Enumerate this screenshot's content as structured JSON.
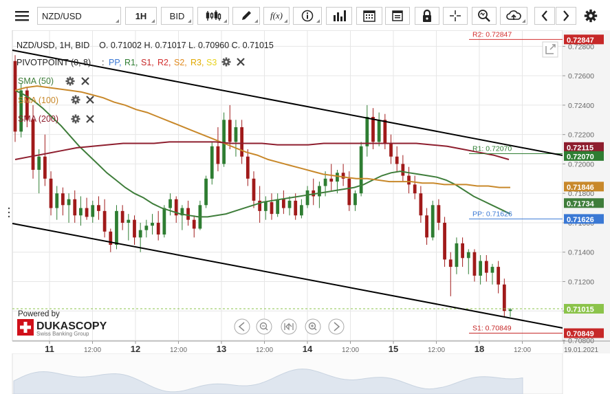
{
  "toolbar": {
    "menu_icon": "hamburger-menu-icon",
    "symbol": "NZD/USD",
    "timeframe": "1H",
    "price_type": "BID",
    "tools": [
      "candles-icon",
      "draw-icon",
      "function-icon",
      "info-icon",
      "volume-icon",
      "calendar-icon",
      "report-icon",
      "lock-icon",
      "crosshair-icon",
      "zoom-icon",
      "upload-icon"
    ],
    "nav_prev_icon": "chevron-left-icon",
    "nav_next_icon": "chevron-right-icon",
    "settings_icon": "gear-icon",
    "function_label": "f(x)"
  },
  "header": {
    "ohlc": "NZD/USD, 1H, BID    O. 0.71002 H. 0.71017 L. 0.70960 C. 0.71015"
  },
  "indicators": {
    "pivot": {
      "name": "PIVOTPOINT (0, 8)",
      "sep": ":",
      "levels": [
        "PP,",
        "R1,",
        "S1,",
        "R2,",
        "S2,",
        "R3,",
        "S3"
      ]
    },
    "sma50": "SMA (50)",
    "sma100": "SMA (100)",
    "sma200": "SMA (200)"
  },
  "branding": {
    "powered_by": "Powered by",
    "name": "DUKASCOPY",
    "tagline": "Swiss Banking Group"
  },
  "colors": {
    "up": "#2e7d32",
    "down": "#a01a1a",
    "sma50": "#3e7d3a",
    "sma100": "#c8882a",
    "sma200": "#8e1e2e",
    "pp": "#3a78d4",
    "r1": "#2e7d32",
    "r2": "#d32f2f",
    "s1": "#c62828",
    "s2": "#e08a1e",
    "r3": "#e0a800",
    "s3": "#e8d21a",
    "grid": "#e6e6e6",
    "trendline": "#000000"
  },
  "chart_data": {
    "type": "candlestick",
    "symbol": "NZD/USD",
    "timeframe": "1H",
    "ylim": [
      0.708,
      0.729
    ],
    "y_ticks": [
      "0.70800",
      "0.71000",
      "0.71200",
      "0.71400",
      "0.71600",
      "0.71800",
      "0.72000",
      "0.72200",
      "0.72400",
      "0.72600",
      "0.72800"
    ],
    "x_ticks": [
      "11",
      "12:00",
      "12",
      "12:00",
      "13",
      "12:00",
      "14",
      "12:00",
      "15",
      "12:00",
      "18",
      "12:00",
      "19.01.2021"
    ],
    "grid": true,
    "candles_ohlc": [
      [
        0.727,
        0.7274,
        0.7215,
        0.7222
      ],
      [
        0.7222,
        0.7255,
        0.7218,
        0.725
      ],
      [
        0.725,
        0.7252,
        0.7225,
        0.723
      ],
      [
        0.723,
        0.724,
        0.719,
        0.7196
      ],
      [
        0.7196,
        0.721,
        0.718,
        0.7205
      ],
      [
        0.7205,
        0.722,
        0.7185,
        0.719
      ],
      [
        0.719,
        0.7195,
        0.7165,
        0.717
      ],
      [
        0.717,
        0.7185,
        0.7162,
        0.718
      ],
      [
        0.718,
        0.7184,
        0.7165,
        0.7172
      ],
      [
        0.7172,
        0.718,
        0.716,
        0.7176
      ],
      [
        0.7176,
        0.7182,
        0.716,
        0.7165
      ],
      [
        0.7165,
        0.7178,
        0.7158,
        0.717
      ],
      [
        0.717,
        0.7177,
        0.7162,
        0.7164
      ],
      [
        0.7164,
        0.7175,
        0.716,
        0.7172
      ],
      [
        0.7172,
        0.7178,
        0.7162,
        0.7168
      ],
      [
        0.7168,
        0.7176,
        0.715,
        0.7154
      ],
      [
        0.7154,
        0.7156,
        0.714,
        0.7145
      ],
      [
        0.7145,
        0.7172,
        0.7142,
        0.7168
      ],
      [
        0.7168,
        0.7172,
        0.7155,
        0.716
      ],
      [
        0.716,
        0.7166,
        0.7148,
        0.7162
      ],
      [
        0.7162,
        0.7165,
        0.7145,
        0.715
      ],
      [
        0.715,
        0.716,
        0.714,
        0.7155
      ],
      [
        0.7155,
        0.7162,
        0.715,
        0.7158
      ],
      [
        0.7158,
        0.7166,
        0.7152,
        0.716
      ],
      [
        0.716,
        0.7168,
        0.7148,
        0.7152
      ],
      [
        0.7152,
        0.7172,
        0.715,
        0.717
      ],
      [
        0.717,
        0.718,
        0.7165,
        0.7176
      ],
      [
        0.7176,
        0.7178,
        0.716,
        0.7165
      ],
      [
        0.7165,
        0.7172,
        0.7155,
        0.717
      ],
      [
        0.717,
        0.7175,
        0.7158,
        0.7162
      ],
      [
        0.7162,
        0.7165,
        0.715,
        0.7156
      ],
      [
        0.7156,
        0.7175,
        0.7155,
        0.7172
      ],
      [
        0.7172,
        0.7192,
        0.717,
        0.719
      ],
      [
        0.719,
        0.7215,
        0.7186,
        0.7212
      ],
      [
        0.7212,
        0.7225,
        0.7195,
        0.72
      ],
      [
        0.72,
        0.7235,
        0.7198,
        0.723
      ],
      [
        0.723,
        0.724,
        0.721,
        0.7215
      ],
      [
        0.7215,
        0.723,
        0.7205,
        0.7225
      ],
      [
        0.7225,
        0.723,
        0.72,
        0.7205
      ],
      [
        0.7205,
        0.721,
        0.7185,
        0.719
      ],
      [
        0.719,
        0.7195,
        0.717,
        0.7175
      ],
      [
        0.7175,
        0.7185,
        0.716,
        0.7168
      ],
      [
        0.7168,
        0.7178,
        0.7162,
        0.7174
      ],
      [
        0.7174,
        0.718,
        0.7162,
        0.7166
      ],
      [
        0.7166,
        0.718,
        0.7164,
        0.7176
      ],
      [
        0.7176,
        0.7182,
        0.7166,
        0.717
      ],
      [
        0.717,
        0.7178,
        0.7165,
        0.7175
      ],
      [
        0.7175,
        0.718,
        0.7162,
        0.7165
      ],
      [
        0.7165,
        0.7176,
        0.7163,
        0.7172
      ],
      [
        0.7172,
        0.7185,
        0.717,
        0.7182
      ],
      [
        0.7182,
        0.719,
        0.7172,
        0.7178
      ],
      [
        0.7178,
        0.7188,
        0.717,
        0.7185
      ],
      [
        0.7185,
        0.7195,
        0.7178,
        0.719
      ],
      [
        0.719,
        0.72,
        0.7182,
        0.7188
      ],
      [
        0.7188,
        0.7196,
        0.718,
        0.7194
      ],
      [
        0.7194,
        0.72,
        0.7185,
        0.719
      ],
      [
        0.719,
        0.7195,
        0.7168,
        0.7172
      ],
      [
        0.7172,
        0.7182,
        0.7168,
        0.718
      ],
      [
        0.718,
        0.7215,
        0.7178,
        0.7212
      ],
      [
        0.7212,
        0.724,
        0.7205,
        0.7232
      ],
      [
        0.7232,
        0.7238,
        0.721,
        0.7215
      ],
      [
        0.7215,
        0.7235,
        0.7212,
        0.723
      ],
      [
        0.723,
        0.7234,
        0.721,
        0.7214
      ],
      [
        0.7214,
        0.722,
        0.72,
        0.7205
      ],
      [
        0.7205,
        0.7212,
        0.7195,
        0.72
      ],
      [
        0.72,
        0.7206,
        0.7188,
        0.7192
      ],
      [
        0.7192,
        0.7198,
        0.718,
        0.7186
      ],
      [
        0.7186,
        0.7192,
        0.7176,
        0.718
      ],
      [
        0.718,
        0.7185,
        0.716,
        0.7165
      ],
      [
        0.7165,
        0.717,
        0.7145,
        0.715
      ],
      [
        0.715,
        0.7175,
        0.7148,
        0.7172
      ],
      [
        0.7172,
        0.7176,
        0.7155,
        0.716
      ],
      [
        0.716,
        0.7164,
        0.713,
        0.7135
      ],
      [
        0.7135,
        0.714,
        0.711,
        0.713
      ],
      [
        0.713,
        0.715,
        0.7125,
        0.7146
      ],
      [
        0.7146,
        0.715,
        0.713,
        0.7136
      ],
      [
        0.7136,
        0.7142,
        0.7125,
        0.714
      ],
      [
        0.714,
        0.7142,
        0.712,
        0.7124
      ],
      [
        0.7124,
        0.7138,
        0.7118,
        0.7134
      ],
      [
        0.7134,
        0.7138,
        0.712,
        0.7126
      ],
      [
        0.7126,
        0.7132,
        0.7118,
        0.713
      ],
      [
        0.713,
        0.7134,
        0.7112,
        0.7118
      ],
      [
        0.7118,
        0.7122,
        0.7096,
        0.71
      ],
      [
        0.71,
        0.7102,
        0.7096,
        0.7101
      ]
    ],
    "series": [
      {
        "name": "SMA (50)",
        "values": [
          0.725,
          0.7247,
          0.7243,
          0.7238,
          0.7232,
          0.7226,
          0.7219,
          0.7212,
          0.7206,
          0.72,
          0.7194,
          0.7189,
          0.7184,
          0.718,
          0.7177,
          0.7173,
          0.717,
          0.7168,
          0.7166,
          0.7165,
          0.7164,
          0.7164,
          0.7165,
          0.7166,
          0.7168,
          0.717,
          0.7172,
          0.7174,
          0.7175,
          0.7176,
          0.7177,
          0.7178,
          0.7179,
          0.718,
          0.7181,
          0.7182,
          0.7183,
          0.7184,
          0.7186,
          0.7189,
          0.7192,
          0.7194,
          0.7195,
          0.7194,
          0.7193,
          0.7192,
          0.7191,
          0.7189,
          0.7186,
          0.7182,
          0.7178,
          0.7175,
          0.7172,
          0.7169,
          0.7166
        ]
      },
      {
        "name": "SMA (100)",
        "values": [
          0.725,
          0.7252,
          0.7253,
          0.7252,
          0.7251,
          0.725,
          0.7249,
          0.7247,
          0.7245,
          0.7242,
          0.724,
          0.7237,
          0.7235,
          0.7232,
          0.7229,
          0.7226,
          0.7223,
          0.722,
          0.7217,
          0.7214,
          0.7211,
          0.7208,
          0.7206,
          0.7203,
          0.7201,
          0.7199,
          0.7197,
          0.7195,
          0.7193,
          0.7192,
          0.7191,
          0.719,
          0.719,
          0.7189,
          0.7188,
          0.7188,
          0.7188,
          0.7187,
          0.7187,
          0.7186,
          0.7186,
          0.7186,
          0.7185,
          0.7185,
          0.7184,
          0.7184
        ]
      },
      {
        "name": "SMA (200)",
        "values": [
          0.7203,
          0.7205,
          0.7207,
          0.7209,
          0.7211,
          0.7212,
          0.7213,
          0.7214,
          0.7214,
          0.7214,
          0.7215,
          0.7215,
          0.7215,
          0.7215,
          0.7214,
          0.7214,
          0.7214,
          0.7213,
          0.7213,
          0.7213,
          0.7214,
          0.7214,
          0.7214,
          0.7214,
          0.7214,
          0.7214,
          0.7214,
          0.7213,
          0.7212,
          0.721,
          0.7208,
          0.7206,
          0.7203
        ]
      }
    ],
    "pivot_levels": [
      {
        "name": "R2",
        "label": "R2: 0.72847",
        "value": 0.72847
      },
      {
        "name": "R1",
        "label": "R1: 0.72070",
        "value": 0.7207
      },
      {
        "name": "PP",
        "label": "PP: 0.71626",
        "value": 0.71626
      },
      {
        "name": "S1",
        "label": "S1: 0.70849",
        "value": 0.70849
      }
    ],
    "price_tags": [
      {
        "text": "0.72847",
        "value": 0.72847,
        "bg": "#c62828"
      },
      {
        "text": "0.72115",
        "value": 0.72115,
        "bg": "#8e1e2e"
      },
      {
        "text": "0.72070",
        "value": 0.7207,
        "bg": "#2e7d32"
      },
      {
        "text": "0.71846",
        "value": 0.71846,
        "bg": "#c8882a"
      },
      {
        "text": "0.71734",
        "value": 0.71734,
        "bg": "#3e7d3a"
      },
      {
        "text": "0.71626",
        "value": 0.71626,
        "bg": "#3a78d4"
      },
      {
        "text": "0.71015",
        "value": 0.71015,
        "bg": "#8bc34a"
      },
      {
        "text": "0.70849",
        "value": 0.70849,
        "bg": "#c62828"
      }
    ],
    "current_price": 0.71015
  }
}
